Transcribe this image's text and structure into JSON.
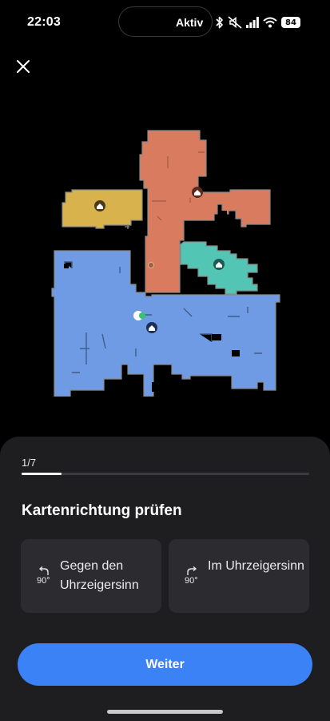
{
  "status_bar": {
    "time": "22:03",
    "island_label": "Aktiv",
    "battery": "84",
    "icons": [
      "bluetooth-icon",
      "mute-icon",
      "signal-icon",
      "wifi-icon",
      "battery-icon"
    ]
  },
  "map": {
    "rooms": [
      {
        "name": "room-orange",
        "color": "#d97b5e"
      },
      {
        "name": "room-yellow",
        "color": "#d8b24d"
      },
      {
        "name": "room-teal",
        "color": "#52c5b5"
      },
      {
        "name": "room-blue",
        "color": "#6e9be3"
      }
    ],
    "icons": [
      "home-icon",
      "charging-dock-icon",
      "robot-position-icon"
    ]
  },
  "sheet": {
    "step": "1/7",
    "progress": 0.14,
    "title": "Kartenrichtung prüfen",
    "options": [
      {
        "degree": "90°",
        "label": "Gegen den Uhrzeigersinn",
        "icon": "rotate-counterclockwise-icon"
      },
      {
        "degree": "90°",
        "label": "Im Uhrzeigersinn",
        "icon": "rotate-clockwise-icon"
      }
    ],
    "primary_button": "Weiter"
  },
  "colors": {
    "accent": "#3b82f6",
    "sheet_bg": "#1e1e20",
    "card_bg": "#2c2c30"
  }
}
